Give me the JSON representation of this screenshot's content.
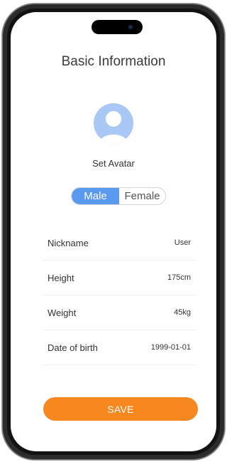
{
  "page": {
    "title": "Basic Information"
  },
  "avatar": {
    "label": "Set Avatar",
    "icon": "user-silhouette-icon"
  },
  "gender": {
    "options": [
      "Male",
      "Female"
    ],
    "selected": "Male"
  },
  "fields": [
    {
      "label": "Nickname",
      "value": "User"
    },
    {
      "label": "Height",
      "value": "175cm"
    },
    {
      "label": "Weight",
      "value": "45kg"
    },
    {
      "label": "Date of birth",
      "value": "1999-01-01"
    }
  ],
  "actions": {
    "save_label": "SAVE"
  },
  "colors": {
    "accent_blue": "#5a99f0",
    "avatar_bg": "#a9c8f6",
    "save_orange": "#f7881f"
  }
}
